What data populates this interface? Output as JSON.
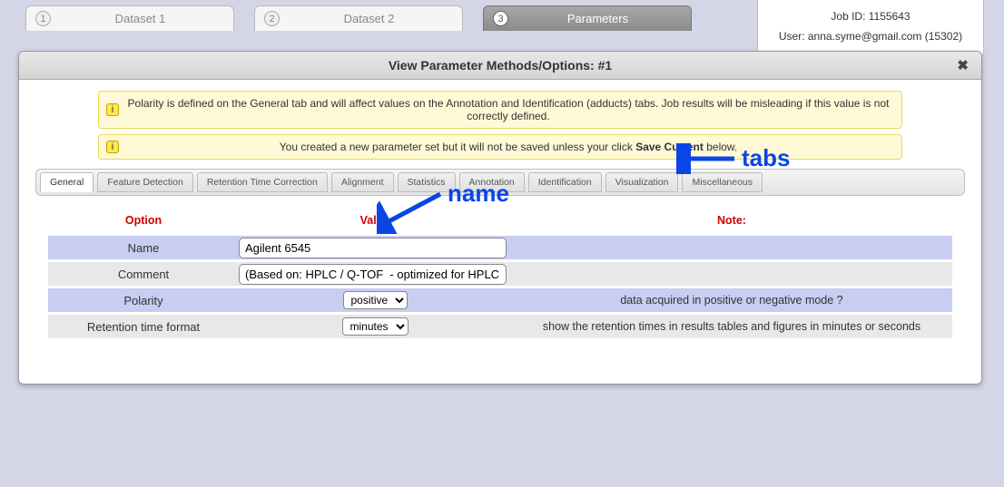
{
  "jobinfo": {
    "jobid_label": "Job ID: 1155643",
    "user_label": "User: anna.syme@gmail.com (15302)"
  },
  "topnav": {
    "items": [
      {
        "num": "1",
        "label": "Dataset 1"
      },
      {
        "num": "2",
        "label": "Dataset 2"
      },
      {
        "num": "3",
        "label": "Parameters"
      }
    ]
  },
  "dialog": {
    "title": "View Parameter Methods/Options: #1",
    "close": "✖"
  },
  "alerts": {
    "a1": "Polarity is defined on the General tab and will affect values on the Annotation and Identification (adducts) tabs. Job results will be misleading if this value is not correctly defined.",
    "a2_pre": "You created a new parameter set but it will not be saved unless your click ",
    "a2_bold": "Save Current",
    "a2_post": " below."
  },
  "subtabs": [
    "General",
    "Feature Detection",
    "Retention Time Correction",
    "Alignment",
    "Statistics",
    "Annotation",
    "Identification",
    "Visualization",
    "Miscellaneous"
  ],
  "headers": {
    "option": "Option",
    "value": "Value",
    "note": "Note:"
  },
  "rows": {
    "name": {
      "label": "Name",
      "value": "Agilent 6545",
      "note": ""
    },
    "comment": {
      "label": "Comment",
      "value": "(Based on: HPLC / Q-TOF  - optimized for HPLC",
      "note": ""
    },
    "polarity": {
      "label": "Polarity",
      "value": "positive",
      "note": "data acquired in positive or negative mode ?"
    },
    "rtf": {
      "label": "Retention time format",
      "value": "minutes",
      "note": "show the retention times in results tables and figures in minutes or seconds"
    }
  },
  "annotations": {
    "name": "name",
    "tabs": "tabs"
  }
}
